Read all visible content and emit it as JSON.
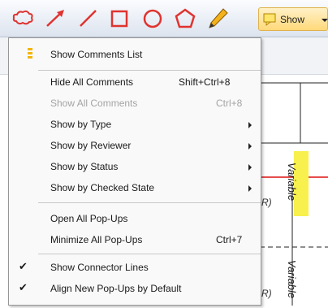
{
  "toolbar": {
    "tools": [
      "cloud-tool-icon",
      "arrow-tool-icon",
      "line-tool-icon",
      "rectangle-tool-icon",
      "oval-tool-icon",
      "polygon-tool-icon",
      "pencil-tool-icon"
    ],
    "show_button": {
      "label": "Show",
      "icon": "comments-icon"
    },
    "accent_color": "#e0332f"
  },
  "menu": {
    "items": [
      {
        "label": "Show Comments List",
        "shortcut": "",
        "icon": "comments-list-icon"
      },
      {
        "label": "Hide All Comments",
        "shortcut": "Shift+Ctrl+8"
      },
      {
        "label": "Show All Comments",
        "shortcut": "Ctrl+8",
        "disabled": true
      },
      {
        "label": "Show by Type",
        "submenu": true
      },
      {
        "label": "Show by Reviewer",
        "submenu": true
      },
      {
        "label": "Show by Status",
        "submenu": true
      },
      {
        "label": "Show by Checked State",
        "submenu": true
      },
      {
        "label": "Open All Pop-Ups",
        "shortcut": ""
      },
      {
        "label": "Minimize All Pop-Ups",
        "shortcut": "Ctrl+7"
      },
      {
        "label": "Show Connector Lines",
        "checked": true
      },
      {
        "label": "Align New Pop-Ups by Default",
        "checked": true
      }
    ]
  },
  "document": {
    "labels": [
      "Variable",
      "Variable"
    ],
    "fragments": [
      "R)",
      "R)"
    ]
  }
}
